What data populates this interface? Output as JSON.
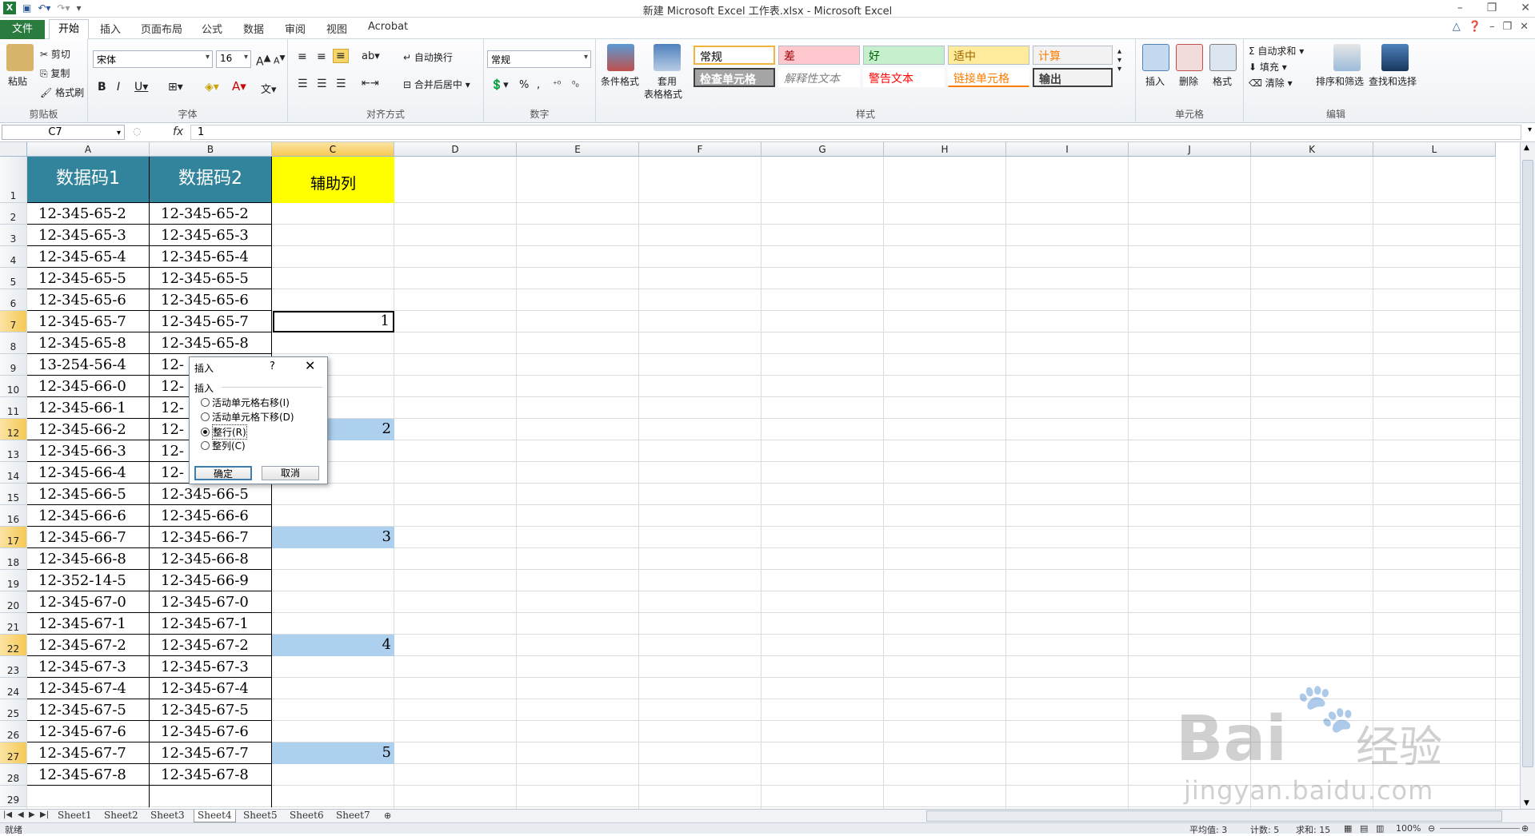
{
  "window": {
    "title": "新建 Microsoft Excel 工作表.xlsx - Microsoft Excel"
  },
  "tabs": {
    "file": "文件",
    "home": "开始",
    "items": [
      "插入",
      "页面布局",
      "公式",
      "数据",
      "审阅",
      "视图",
      "Acrobat"
    ]
  },
  "ribbon": {
    "clipboard": {
      "label": "剪贴板",
      "paste": "粘贴",
      "cut": "剪切",
      "copy": "复制",
      "format_painter": "格式刷"
    },
    "font": {
      "label": "字体",
      "name": "宋体",
      "size": "16"
    },
    "alignment": {
      "label": "对齐方式",
      "wrap": "自动换行",
      "merge": "合并后居中"
    },
    "number": {
      "label": "数字",
      "format": "常规"
    },
    "styles": {
      "label": "样式",
      "cond_format": "条件格式",
      "table_format_1": "套用",
      "table_format_2": "表格格式",
      "cells": [
        {
          "text": "常规",
          "bg": "#ffffff",
          "fg": "#000000"
        },
        {
          "text": "差",
          "bg": "#ffc7ce",
          "fg": "#9c0006"
        },
        {
          "text": "好",
          "bg": "#c6efce",
          "fg": "#006100"
        },
        {
          "text": "适中",
          "bg": "#ffeb9c",
          "fg": "#9c6500"
        },
        {
          "text": "计算",
          "bg": "#f2f2f2",
          "fg": "#fa7d00"
        },
        {
          "text": "检查单元格",
          "bg": "#a5a5a5",
          "fg": "#ffffff"
        },
        {
          "text": "解释性文本",
          "bg": "#ffffff",
          "fg": "#7f7f7f"
        },
        {
          "text": "警告文本",
          "bg": "#ffffff",
          "fg": "#ff0000"
        },
        {
          "text": "链接单元格",
          "bg": "#ffffff",
          "fg": "#fa7d00"
        },
        {
          "text": "输出",
          "bg": "#f2f2f2",
          "fg": "#3f3f3f"
        }
      ]
    },
    "cells_group": {
      "label": "单元格",
      "insert": "插入",
      "delete": "删除",
      "format": "格式"
    },
    "editing": {
      "label": "编辑",
      "autosum": "自动求和",
      "fill": "填充",
      "clear": "清除",
      "sort": "排序和筛选",
      "find": "查找和选择"
    }
  },
  "formula_bar": {
    "name_box": "C7",
    "fx": "fx",
    "value": "1"
  },
  "columns": [
    "A",
    "B",
    "C",
    "D",
    "E",
    "F",
    "G",
    "H",
    "I",
    "J",
    "K",
    "L"
  ],
  "sheet": {
    "header": {
      "a": "数据码1",
      "b": "数据码2",
      "c": "辅助列"
    },
    "rows": [
      [
        "12-345-65-2",
        "12-345-65-2",
        ""
      ],
      [
        "12-345-65-3",
        "12-345-65-3",
        ""
      ],
      [
        "12-345-65-4",
        "12-345-65-4",
        ""
      ],
      [
        "12-345-65-5",
        "12-345-65-5",
        ""
      ],
      [
        "12-345-65-6",
        "12-345-65-6",
        ""
      ],
      [
        "12-345-65-7",
        "12-345-65-7",
        "1"
      ],
      [
        "12-345-65-8",
        "12-345-65-8",
        ""
      ],
      [
        "13-254-56-4",
        "12-",
        ""
      ],
      [
        "12-345-66-0",
        "12-",
        ""
      ],
      [
        "12-345-66-1",
        "12-",
        ""
      ],
      [
        "12-345-66-2",
        "12-",
        "2"
      ],
      [
        "12-345-66-3",
        "12-",
        ""
      ],
      [
        "12-345-66-4",
        "12-",
        ""
      ],
      [
        "12-345-66-5",
        "12-345-66-5",
        ""
      ],
      [
        "12-345-66-6",
        "12-345-66-6",
        ""
      ],
      [
        "12-345-66-7",
        "12-345-66-7",
        "3"
      ],
      [
        "12-345-66-8",
        "12-345-66-8",
        ""
      ],
      [
        "12-352-14-5",
        "12-345-66-9",
        ""
      ],
      [
        "12-345-67-0",
        "12-345-67-0",
        ""
      ],
      [
        "12-345-67-1",
        "12-345-67-1",
        ""
      ],
      [
        "12-345-67-2",
        "12-345-67-2",
        "4"
      ],
      [
        "12-345-67-3",
        "12-345-67-3",
        ""
      ],
      [
        "12-345-67-4",
        "12-345-67-4",
        ""
      ],
      [
        "12-345-67-5",
        "12-345-67-5",
        ""
      ],
      [
        "12-345-67-6",
        "12-345-67-6",
        ""
      ],
      [
        "12-345-67-7",
        "12-345-67-7",
        "5"
      ],
      [
        "12-345-67-8",
        "12-345-67-8",
        ""
      ],
      [
        "",
        "",
        " "
      ]
    ],
    "row_numbers": [
      "1",
      "2",
      "3",
      "4",
      "5",
      "6",
      "7",
      "8",
      "9",
      "10",
      "11",
      "12",
      "13",
      "14",
      "15",
      "16",
      "17",
      "18",
      "19",
      "20",
      "21",
      "22",
      "23",
      "24",
      "25",
      "26",
      "27",
      "28",
      "29"
    ]
  },
  "dialog": {
    "title": "插入",
    "help": "?",
    "close": "✕",
    "group_label": "插入",
    "options": [
      "活动单元格右移(I)",
      "活动单元格下移(D)",
      "整行(R)",
      "整列(C)"
    ],
    "ok": "确定",
    "cancel": "取消"
  },
  "sheet_tabs": [
    "Sheet1",
    "Sheet2",
    "Sheet3",
    "Sheet4",
    "Sheet5",
    "Sheet6",
    "Sheet7"
  ],
  "status": {
    "ready": "就绪",
    "average": "平均值: 3",
    "count": "计数: 5",
    "sum": "求和: 15",
    "zoom": "100%"
  },
  "watermark": {
    "brand": "Bai",
    "suffix": "经验",
    "url": "jingyan.baidu.com"
  }
}
